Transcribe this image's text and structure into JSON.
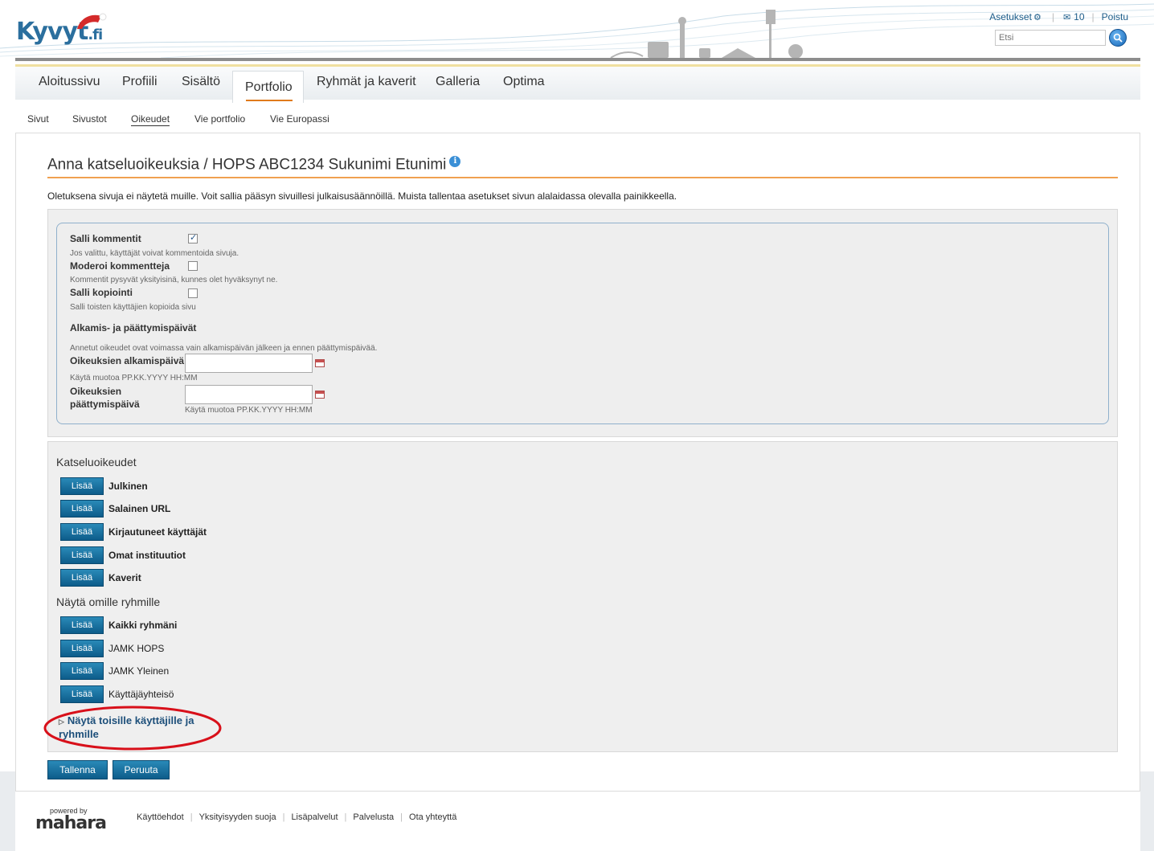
{
  "header": {
    "logo_text": "Kyvyt",
    "logo_suffix": ".fi",
    "settings_label": "Asetukset",
    "messages_count": "10",
    "logout_label": "Poistu",
    "search_placeholder": "Etsi"
  },
  "nav": {
    "items": [
      "Aloitussivu",
      "Profiili",
      "Sisältö",
      "Portfolio",
      "Ryhmät ja kaverit",
      "Galleria",
      "Optima"
    ]
  },
  "subnav": {
    "items": [
      "Sivut",
      "Sivustot",
      "Oikeudet",
      "Vie portfolio",
      "Vie Europassi"
    ]
  },
  "page": {
    "title": "Anna katseluoikeuksia / HOPS ABC1234 Sukunimi Etunimi",
    "intro": "Oletuksena sivuja ei näytetä muille. Voit sallia pääsyn sivuillesi julkaisusäännöillä. Muista tallentaa asetukset sivun alalaidassa olevalla painikkeella."
  },
  "settings": {
    "allow_comments_label": "Salli kommentit",
    "allow_comments_desc": "Jos valittu, käyttäjät voivat kommentoida sivuja.",
    "allow_comments_checked": true,
    "moderate_label": "Moderoi kommentteja",
    "moderate_desc": "Kommentit pysyvät yksityisinä, kunnes olet hyväksynyt ne.",
    "moderate_checked": false,
    "copy_label": "Salli kopiointi",
    "copy_desc": "Salli toisten käyttäjien kopioida sivu",
    "copy_checked": false,
    "dates_heading": "Alkamis- ja päättymispäivät",
    "dates_desc": "Annetut oikeudet ovat voimassa vain alkamispäivän jälkeen ja ennen päättymispäivää.",
    "start_label": "Oikeuksien alkamispäivä",
    "start_hint": "Käytä muotoa PP.KK.YYYY HH:MM",
    "end_label_1": "Oikeuksien",
    "end_label_2": "päättymispäivä",
    "end_hint": "Käytä muotoa PP.KK.YYYY HH:MM"
  },
  "access": {
    "heading": "Katseluoikeudet",
    "add_label": "Lisää",
    "items": [
      "Julkinen",
      "Salainen URL",
      "Kirjautuneet käyttäjät",
      "Omat instituutiot",
      "Kaverit"
    ],
    "groups_heading": "Näytä omille ryhmille",
    "groups": [
      "Kaikki ryhmäni",
      "JAMK HOPS",
      "JAMK Yleinen",
      "Käyttäjäyhteisö"
    ],
    "others_toggle": "Näytä toisille käyttäjille ja ryhmille"
  },
  "actions": {
    "save": "Tallenna",
    "cancel": "Peruuta"
  },
  "footer": {
    "powered_by": "powered by",
    "brand": "mahara",
    "links": [
      "Käyttöehdot",
      "Yksityisyyden suoja",
      "Lisäpalvelut",
      "Palvelusta",
      "Ota yhteyttä"
    ]
  }
}
